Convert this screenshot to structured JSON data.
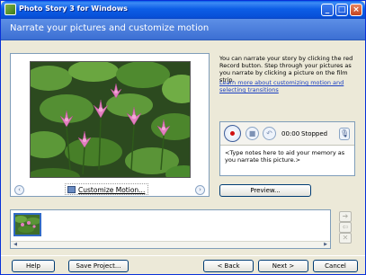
{
  "window": {
    "title": "Photo Story 3 for Windows",
    "controls": {
      "minimize": "_",
      "maximize": "□",
      "close": "×"
    }
  },
  "header": {
    "title": "Narrate your pictures and customize motion"
  },
  "image_panel": {
    "customize_motion_label": "Customize Motion...",
    "prev_glyph": "‹",
    "next_glyph": "›"
  },
  "instructions": {
    "text": "You can narrate your story by clicking the red Record button. Step through your pictures as you narrate by clicking a picture on the film strip.",
    "link": "Learn more about customizing motion and selecting transitions"
  },
  "recording": {
    "time": "00:00",
    "status": "Stopped",
    "stop_glyph": "■",
    "undo_glyph": "↶",
    "mic_glyph": "🎙",
    "notes_placeholder": "<Type notes here to aid your memory as you narrate this picture.>"
  },
  "preview_label": "Preview...",
  "filmstrip": {
    "side_buttons": [
      "➔",
      "⇦",
      "✕"
    ],
    "scroll_left": "◀",
    "scroll_right": "▶"
  },
  "footer": {
    "help": "Help",
    "save_project": "Save Project...",
    "back": "< Back",
    "next": "Next >",
    "cancel": "Cancel"
  },
  "colors": {
    "titlebar": "#0a5fe8",
    "header": "#4a7fdc",
    "record_dot": "#d01010",
    "link": "#1a3fc2"
  }
}
